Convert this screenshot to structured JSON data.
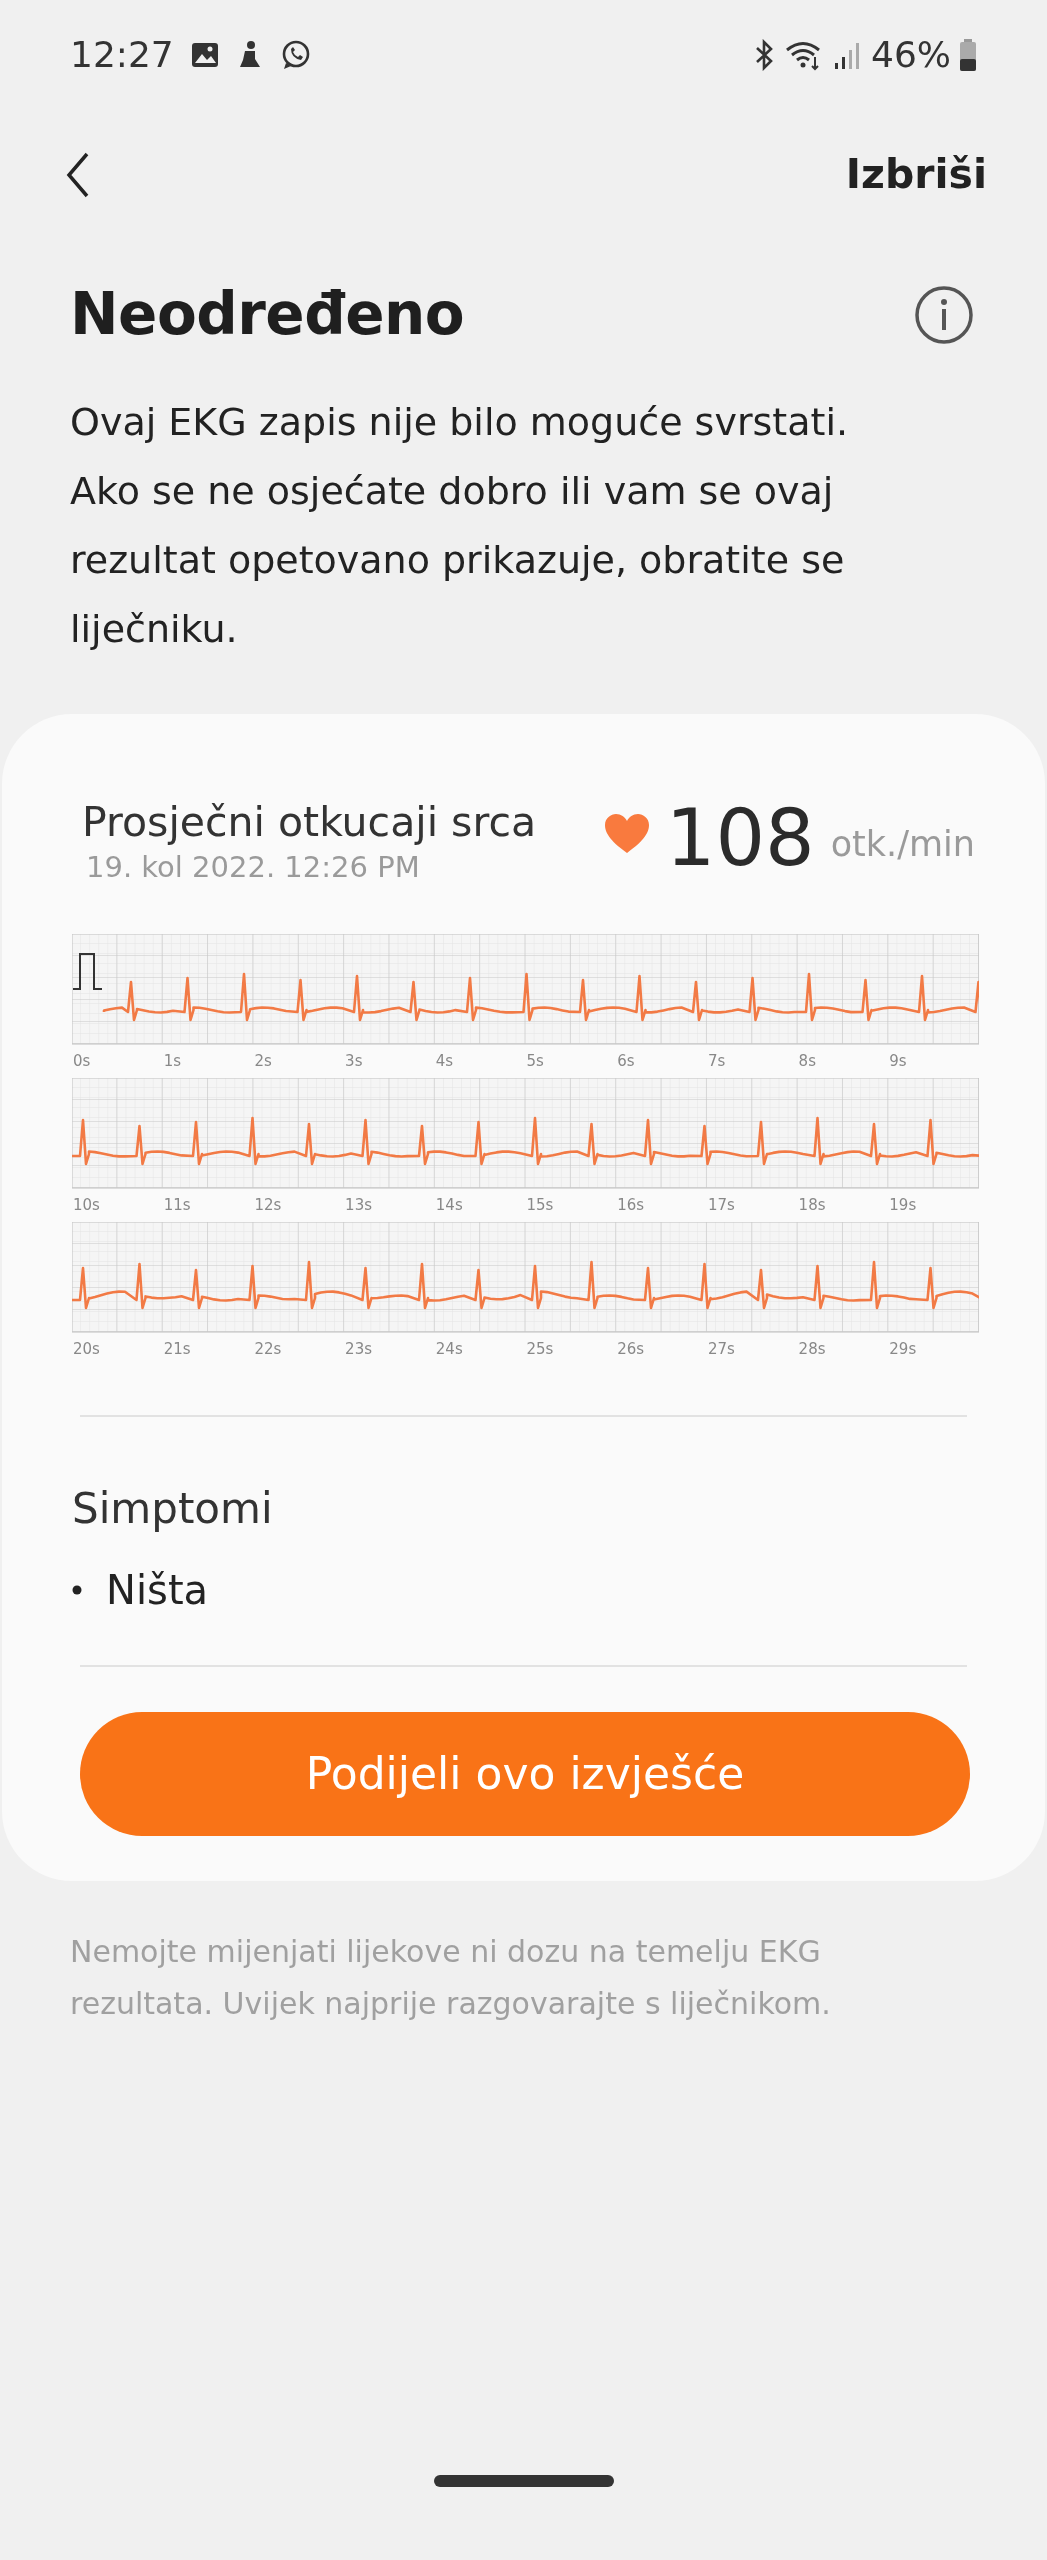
{
  "status_bar": {
    "time": "12:27",
    "battery": "46%"
  },
  "header": {
    "action": "Izbriši"
  },
  "result": {
    "title": "Neodređeno",
    "description": "Ovaj EKG zapis nije bilo moguće svrstati. Ako se ne osjećate dobro ili vam se ovaj rezultat opetovano prikazuje, obratite se liječniku."
  },
  "card": {
    "label": "Prosječni otkucaji srca",
    "timestamp": "19. kol 2022. 12:26 PM",
    "bpm": "108",
    "unit": "otk./min",
    "strips": [
      {
        "calibration": true,
        "ticks": [
          "0s",
          "1s",
          "2s",
          "3s",
          "4s",
          "5s",
          "6s",
          "7s",
          "8s",
          "9s"
        ]
      },
      {
        "calibration": false,
        "ticks": [
          "10s",
          "11s",
          "12s",
          "13s",
          "14s",
          "15s",
          "16s",
          "17s",
          "18s",
          "19s"
        ]
      },
      {
        "calibration": false,
        "ticks": [
          "20s",
          "21s",
          "22s",
          "23s",
          "24s",
          "25s",
          "26s",
          "27s",
          "28s",
          "29s"
        ]
      }
    ],
    "symptoms_title": "Simptomi",
    "symptoms": [
      "Ništa"
    ],
    "share_button": "Podijeli ovo izvješće"
  },
  "disclaimer": "Nemojte mijenjati lijekove ni dozu na temelju EKG rezultata. Uvijek najprije razgovarajte s liječnikom."
}
